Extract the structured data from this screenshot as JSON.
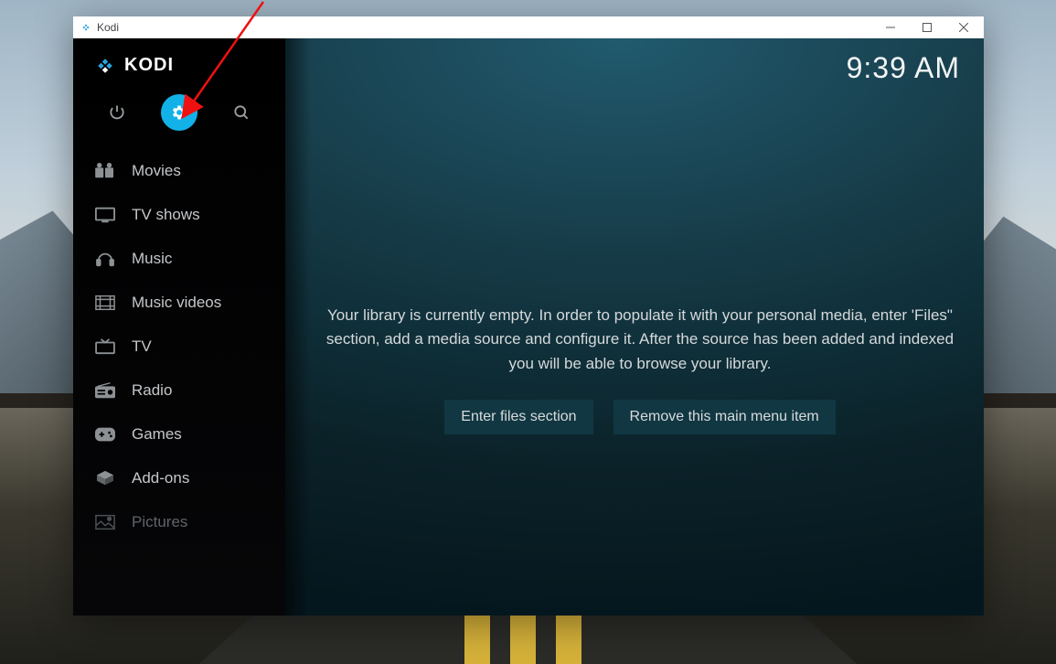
{
  "window": {
    "title": "Kodi"
  },
  "app": {
    "logo_text": "KODI",
    "clock": "9:39 AM"
  },
  "top_buttons": {
    "power": "power-icon",
    "settings": "gear-icon",
    "search": "search-icon",
    "active": "settings"
  },
  "sidebar": {
    "items": [
      {
        "label": "Movies",
        "icon": "movies-icon"
      },
      {
        "label": "TV shows",
        "icon": "tv-shows-icon"
      },
      {
        "label": "Music",
        "icon": "music-icon"
      },
      {
        "label": "Music videos",
        "icon": "music-videos-icon"
      },
      {
        "label": "TV",
        "icon": "tv-icon"
      },
      {
        "label": "Radio",
        "icon": "radio-icon"
      },
      {
        "label": "Games",
        "icon": "games-icon"
      },
      {
        "label": "Add-ons",
        "icon": "addons-icon"
      },
      {
        "label": "Pictures",
        "icon": "pictures-icon"
      }
    ]
  },
  "main": {
    "empty_message": "Your library is currently empty. In order to populate it with your personal media, enter 'Files\" section, add a media source and configure it. After the source has been added and indexed you will be able to browse your library.",
    "buttons": {
      "enter_files": "Enter files section",
      "remove_item": "Remove this main menu item"
    }
  },
  "annotation": {
    "arrow_target": "settings-button"
  }
}
